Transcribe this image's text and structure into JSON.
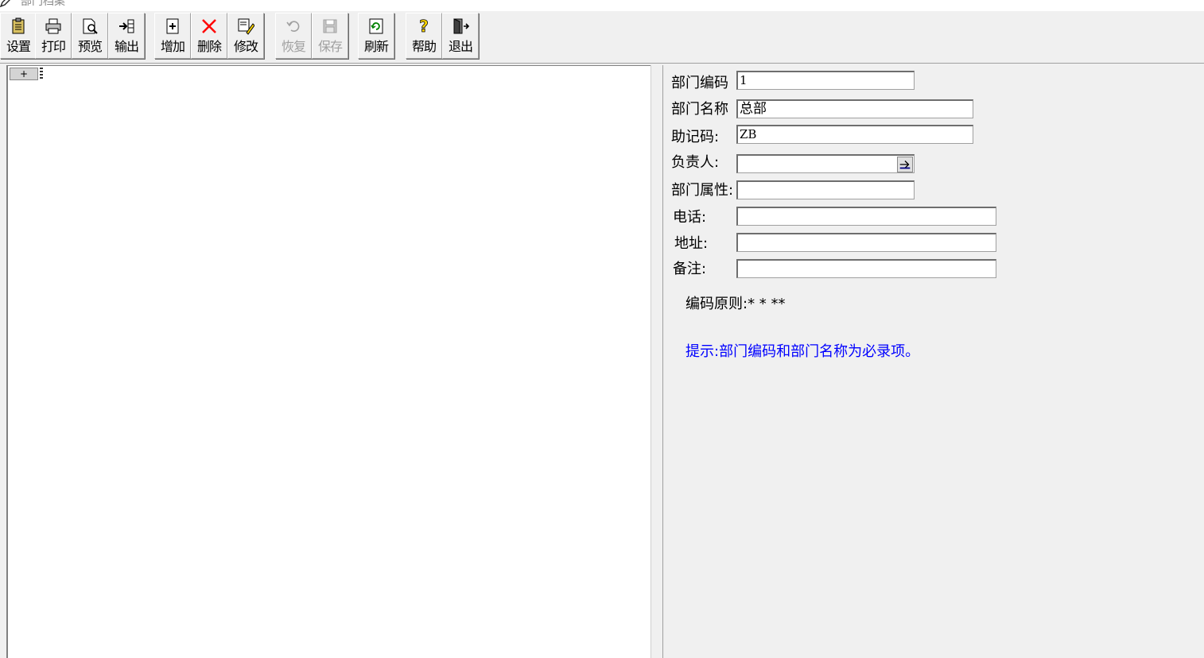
{
  "window": {
    "title": "部门档案"
  },
  "toolbar": {
    "buttons": [
      {
        "label": "设置"
      },
      {
        "label": "打印"
      },
      {
        "label": "预览"
      },
      {
        "label": "输出"
      },
      {
        "label": "增加"
      },
      {
        "label": "删除"
      },
      {
        "label": "修改"
      },
      {
        "label": "恢复"
      },
      {
        "label": "保存"
      },
      {
        "label": "刷新"
      },
      {
        "label": "帮助"
      },
      {
        "label": "退出"
      }
    ]
  },
  "tree": {
    "expander": "+"
  },
  "form": {
    "dept_code": {
      "label": "部门编码",
      "value": "1"
    },
    "dept_name": {
      "label": "部门名称",
      "value": "总部"
    },
    "mnemonic": {
      "label": "助记码:",
      "value": "ZB"
    },
    "manager": {
      "label": "负责人:",
      "value": ""
    },
    "dept_attr": {
      "label": "部门属性:",
      "value": ""
    },
    "phone": {
      "label": "电话:",
      "value": ""
    },
    "address": {
      "label": "地址:",
      "value": ""
    },
    "remark": {
      "label": "备注:",
      "value": ""
    },
    "code_rule": "编码原则:* * **",
    "hint": "提示:部门编码和部门名称为必录项。"
  },
  "colors": {
    "hint": "#0000ff",
    "delete_icon": "#ff0000"
  }
}
